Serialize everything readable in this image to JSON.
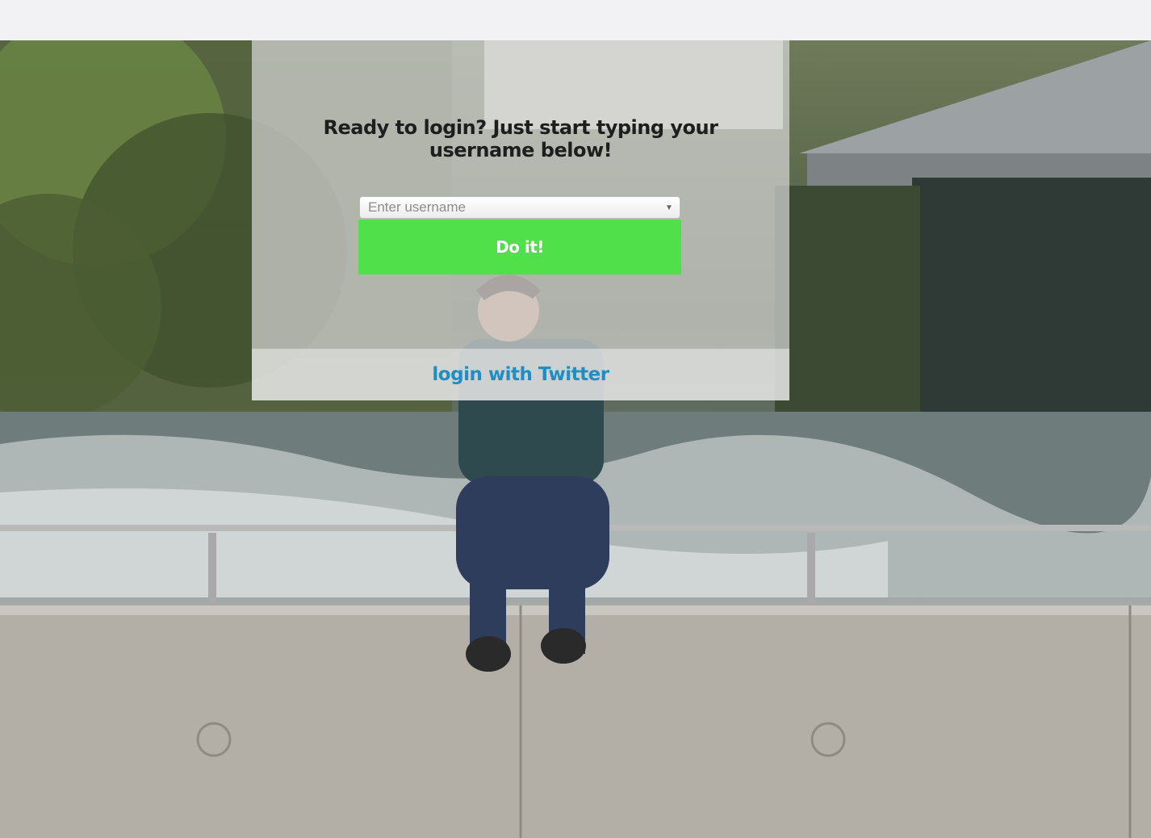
{
  "login": {
    "headline": "Ready to login? Just start typing your username below!",
    "username_placeholder": "Enter username",
    "submit_label": "Do it!"
  },
  "alt_login": {
    "twitter_label": "login with Twitter"
  },
  "colors": {
    "submit_bg": "#4fe04a",
    "link": "#1f8ec2",
    "top_bar": "#f2f2f5"
  },
  "icons": {
    "select_caret": "triangle-down-icon"
  }
}
